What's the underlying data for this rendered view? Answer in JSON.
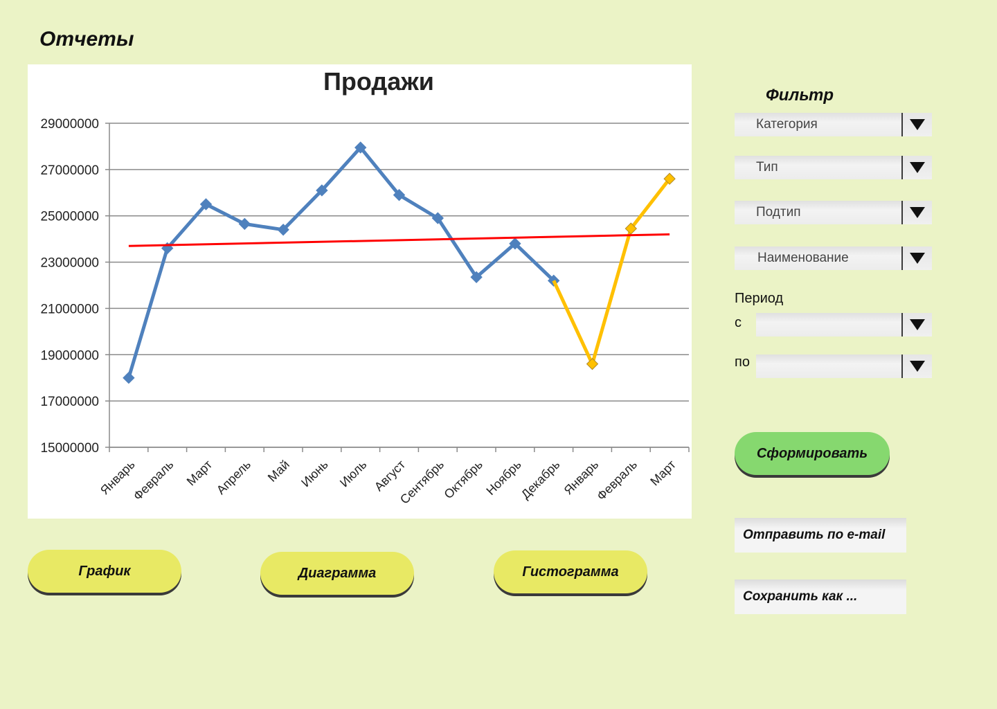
{
  "page": {
    "title": "Отчеты"
  },
  "chart_data": {
    "type": "line",
    "title": "Продажи",
    "categories": [
      "Январь",
      "Февраль",
      "Март",
      "Апрель",
      "Май",
      "Июнь",
      "Июль",
      "Август",
      "Сентябрь",
      "Октябрь",
      "Ноябрь",
      "Декабрь",
      "Январь",
      "Февраль",
      "Март"
    ],
    "ylim": [
      15000000,
      29000000
    ],
    "yticks": [
      29000000,
      27000000,
      25000000,
      23000000,
      21000000,
      19000000,
      17000000,
      15000000
    ],
    "ytick_labels": [
      "29000000",
      "27000000",
      "25000000",
      "23000000",
      "21000000",
      "19000000",
      "17000000",
      "15000000"
    ],
    "grid": true,
    "series": [
      {
        "color": "#4f81bd",
        "x_index": [
          0,
          1,
          2,
          3,
          4,
          5,
          6,
          7,
          8,
          9,
          10,
          11
        ],
        "values": [
          18000000,
          23600000,
          25500000,
          24650000,
          24400000,
          26100000,
          27950000,
          25900000,
          24900000,
          22350000,
          23800000,
          22200000
        ]
      },
      {
        "color": "#ffc000",
        "x_index": [
          11,
          12,
          13,
          14
        ],
        "values": [
          22200000,
          18600000,
          24450000,
          26600000
        ]
      },
      {
        "color": "#ff0000",
        "trend": true,
        "x_index": [
          0,
          14
        ],
        "values": [
          23700000,
          24200000
        ]
      }
    ]
  },
  "views": {
    "graph_label": "График",
    "diagram_label": "Диаграмма",
    "histogram_label": "Гистограмма"
  },
  "filter": {
    "title": "Фильтр",
    "category_label": "Категория",
    "type_label": "Тип",
    "subtype_label": "Подтип",
    "name_label": "Наименование",
    "period_label": "Период",
    "from_label": "с",
    "to_label": "по",
    "from_value": "",
    "to_value": ""
  },
  "actions": {
    "generate_label": "Сформировать",
    "email_label": "Отправить по e-mail",
    "save_as_label": "Сохранить как ..."
  }
}
